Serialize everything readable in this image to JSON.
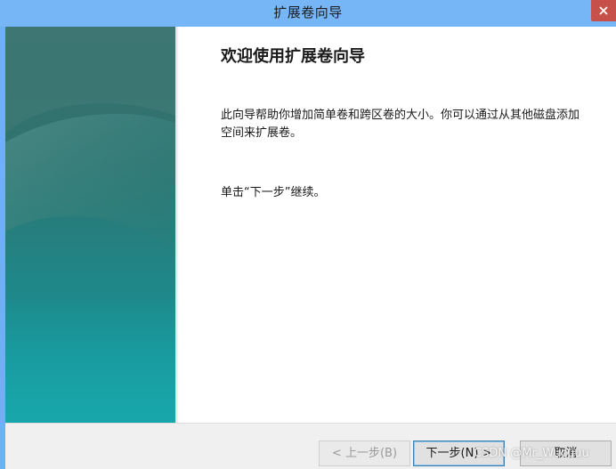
{
  "window": {
    "title": "扩展卷向导"
  },
  "wizard": {
    "heading": "欢迎使用扩展卷向导",
    "description": "此向导帮助你增加简单卷和跨区卷的大小。你可以通过从其他磁盘添加空间来扩展卷。",
    "continue_hint": "单击“下一步”继续。"
  },
  "buttons": {
    "back_label": "< 上一步(B)",
    "next_label": "下一步(N) >",
    "cancel_label": "取消"
  },
  "watermark": {
    "text": "CSDN @Mr_Wucuuu"
  },
  "colors": {
    "titlebar": "#76b5f6",
    "close_button": "#c7504b",
    "side_panel_top": "#2f6e6b",
    "side_panel_bottom": "#13999e"
  },
  "icons": {
    "close": "close-icon"
  }
}
